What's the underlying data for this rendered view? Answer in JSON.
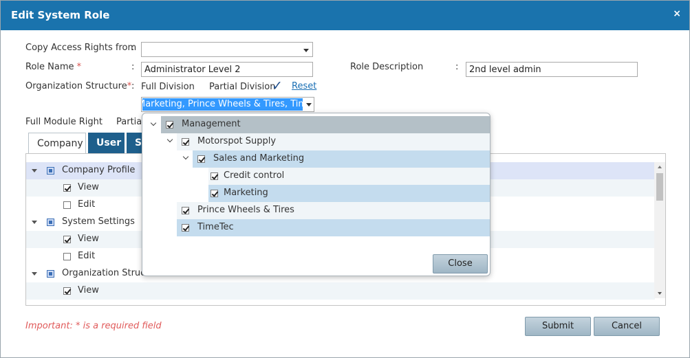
{
  "dialog": {
    "title": "Edit System Role",
    "close_glyph": "×"
  },
  "form": {
    "copy_access_label": "Copy Access Rights from",
    "copy_access_value": "",
    "role_name_label": "Role Name",
    "required_mark": "*",
    "role_name_value": "Administrator Level 2",
    "role_description_label": "Role Description",
    "role_description_value": "2nd level admin",
    "org_structure_label": "Organization Structure",
    "full_division_label": "Full Division",
    "partial_division_label": "Partial Division",
    "checkmark_glyph": "✓",
    "reset_label": "Reset",
    "org_selected_text": "Marketing, Prince Wheels & Tires, TimeTec",
    "full_module_right_label": "Full Module Right",
    "partial_module_label": "Partial",
    "colon": ":"
  },
  "tabs": [
    {
      "label": "Company"
    },
    {
      "label": "User"
    },
    {
      "label": "S"
    }
  ],
  "rights_tree": [
    {
      "label": "Company Profile"
    },
    {
      "label": "View",
      "checked": true
    },
    {
      "label": "Edit",
      "checked": false
    },
    {
      "label": "System Settings"
    },
    {
      "label": "View",
      "checked": true
    },
    {
      "label": "Edit",
      "checked": false
    },
    {
      "label": "Organization Structu"
    },
    {
      "label": "View",
      "checked": true
    }
  ],
  "org_popup": {
    "items": [
      {
        "label": "Management",
        "checked": true
      },
      {
        "label": "Motorspot Supply",
        "checked": true
      },
      {
        "label": "Sales and Marketing",
        "checked": true
      },
      {
        "label": "Credit control",
        "checked": true
      },
      {
        "label": "Marketing",
        "checked": true
      },
      {
        "label": "Prince Wheels & Tires",
        "checked": true
      },
      {
        "label": "TimeTec",
        "checked": true
      }
    ],
    "close_label": "Close"
  },
  "footer": {
    "important_note": "Important: * is a required field",
    "submit_label": "Submit",
    "cancel_label": "Cancel"
  },
  "colors": {
    "titlebar": "#1a73ad",
    "tab_dark": "#1e5f8c",
    "required": "#d9534f",
    "selection": "#3399ff"
  }
}
